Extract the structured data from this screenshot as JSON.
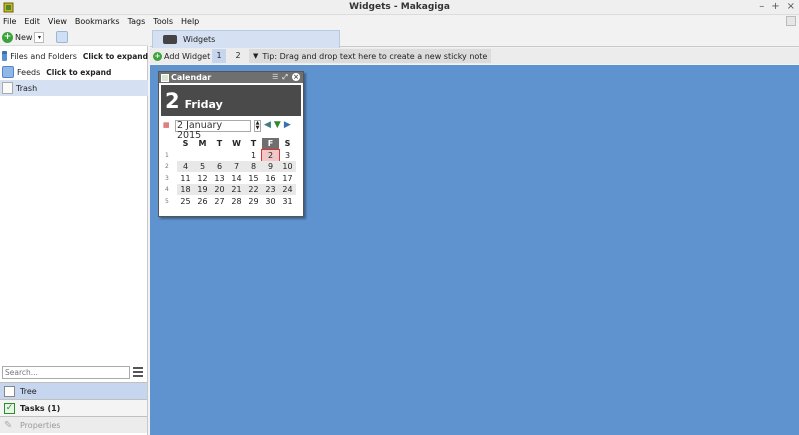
{
  "window": {
    "title": "Widgets - Makagiga",
    "controls": [
      "–",
      "+",
      "×"
    ]
  },
  "menu": [
    "File",
    "Edit",
    "View",
    "Bookmarks",
    "Tags",
    "Tools",
    "Help"
  ],
  "left_toolbar": {
    "new_label": "New"
  },
  "tree": [
    {
      "label": "Files and Folders",
      "hint": "Click to expand",
      "icon": "folder-icon"
    },
    {
      "label": "Feeds",
      "hint": "Click to expand",
      "icon": "feed-icon"
    },
    {
      "label": "Trash",
      "hint": "",
      "icon": "trash-icon"
    }
  ],
  "search": {
    "placeholder": "Search..."
  },
  "side_tabs": {
    "tree": "Tree",
    "tasks": "Tasks (1)",
    "properties": "Properties"
  },
  "main_tab": {
    "label": "Widgets"
  },
  "widget_bar": {
    "add_label": "Add Widget",
    "pages": [
      "1",
      "2"
    ],
    "tip": "Tip: Drag and drop text here to create a new sticky note"
  },
  "calendar": {
    "title": "Calendar",
    "day_number": "2",
    "day_name": "Friday",
    "date_value": "2 January 2015",
    "weekdays": [
      "S",
      "M",
      "T",
      "W",
      "T",
      "F",
      "S"
    ],
    "weeks": [
      {
        "num": "1",
        "days": [
          "",
          "",
          "",
          "",
          "1",
          "2",
          "3"
        ]
      },
      {
        "num": "2",
        "days": [
          "4",
          "5",
          "6",
          "7",
          "8",
          "9",
          "10"
        ]
      },
      {
        "num": "3",
        "days": [
          "11",
          "12",
          "13",
          "14",
          "15",
          "16",
          "17"
        ]
      },
      {
        "num": "4",
        "days": [
          "18",
          "19",
          "20",
          "21",
          "22",
          "23",
          "24"
        ]
      },
      {
        "num": "5",
        "days": [
          "25",
          "26",
          "27",
          "28",
          "29",
          "30",
          "31"
        ]
      }
    ]
  },
  "colors": {
    "desktop": "#5e93d0",
    "selection": "#d5e1f2"
  }
}
